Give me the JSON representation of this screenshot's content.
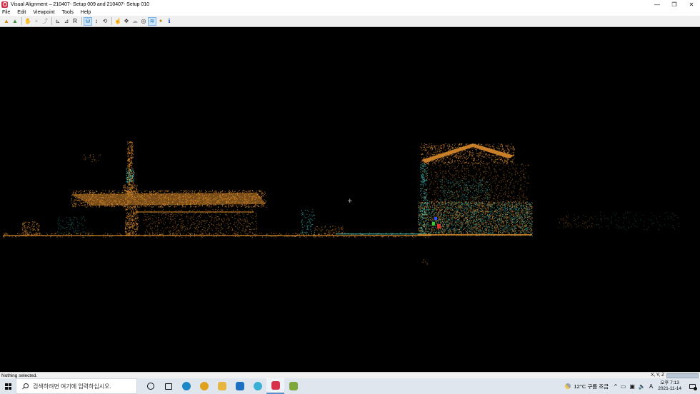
{
  "window": {
    "title": "Visual Alignment – 210407- Setup 009 and 210407- Setup 010",
    "minimize_glyph": "—",
    "restore_glyph": "❐",
    "close_glyph": "✕"
  },
  "menu": {
    "items": [
      {
        "label": "File"
      },
      {
        "label": "Edit"
      },
      {
        "label": "Viewpoint"
      },
      {
        "label": "Tools"
      },
      {
        "label": "Help"
      }
    ]
  },
  "toolbar": {
    "groups": [
      [
        {
          "name": "import-scan-icon",
          "glyph": "▲",
          "color": "#c98a1c"
        },
        {
          "name": "export-scan-icon",
          "glyph": "▲",
          "color": "#3b8f3b"
        }
      ],
      [
        {
          "name": "hand-tool-icon",
          "glyph": "✋",
          "color": "#333333"
        },
        {
          "name": "add-point-icon",
          "glyph": "+",
          "color": "#999999"
        },
        {
          "name": "link-icon",
          "glyph": "⤴",
          "color": "#999999"
        }
      ],
      [
        {
          "name": "axis-xy-icon",
          "glyph": "⊾",
          "color": "#333333"
        },
        {
          "name": "axis-xz-icon",
          "glyph": "⊿",
          "color": "#333333"
        },
        {
          "name": "reset-icon",
          "glyph": "R",
          "color": "#111111"
        }
      ],
      [
        {
          "name": "top-view-icon",
          "glyph": "⛁",
          "color": "#1f6fb5",
          "active": true
        },
        {
          "name": "vertical-move-icon",
          "glyph": "↕",
          "color": "#333333"
        },
        {
          "name": "rotate-view-icon",
          "glyph": "⟲",
          "color": "#333333"
        }
      ],
      [
        {
          "name": "select-icon",
          "glyph": "☝",
          "color": "#333333"
        },
        {
          "name": "pan-icon",
          "glyph": "✥",
          "color": "#333333"
        },
        {
          "name": "cloud-icon",
          "glyph": "☁",
          "color": "#aaaaaa"
        },
        {
          "name": "orbit-icon",
          "glyph": "◎",
          "color": "#333333"
        },
        {
          "name": "layers-icon",
          "glyph": "≋",
          "color": "#1f6fb5",
          "active": true
        },
        {
          "name": "settings-icon",
          "glyph": "✦",
          "color": "#b8860b"
        },
        {
          "name": "info-icon",
          "glyph": "ℹ",
          "color": "#1f4fb5"
        }
      ]
    ]
  },
  "viewport": {
    "cursor_glyph": "+",
    "orange": "#d98a2b",
    "cyan": "#3fd6d0",
    "axis_colors": {
      "x": "#e03030",
      "y": "#30d030",
      "z": "#3050ff"
    }
  },
  "status": {
    "text": "Nothing selected.",
    "coord_label": "X, Y, Z"
  },
  "taskbar": {
    "search_placeholder": "검색하려면 여기에 입력하십시오.",
    "apps": [
      {
        "name": "cortana-icon",
        "color": "#111111",
        "shape": "ring"
      },
      {
        "name": "task-view-icon",
        "color": "#111111",
        "shape": "square"
      },
      {
        "name": "edge-icon",
        "color": "#1b88c9",
        "shape": "circle"
      },
      {
        "name": "chrome-icon",
        "color": "#e0a21c",
        "shape": "circle"
      },
      {
        "name": "file-explorer-icon",
        "color": "#e6b640",
        "shape": "square"
      },
      {
        "name": "mail-icon",
        "color": "#1c6fc2",
        "shape": "square"
      },
      {
        "name": "photos-icon",
        "color": "#3bb0d6",
        "shape": "circle"
      },
      {
        "name": "visual-alignment-taskbar-icon",
        "color": "#d8324a",
        "shape": "square",
        "active": true
      },
      {
        "name": "paint-icon",
        "color": "#7fa83a",
        "shape": "square"
      }
    ],
    "weather": "12°C 구름 조금",
    "tray_glyphs": [
      "^",
      "▭",
      "▣",
      "🔈",
      "A"
    ],
    "time": "오후 7:13",
    "date": "2021-11-14"
  }
}
